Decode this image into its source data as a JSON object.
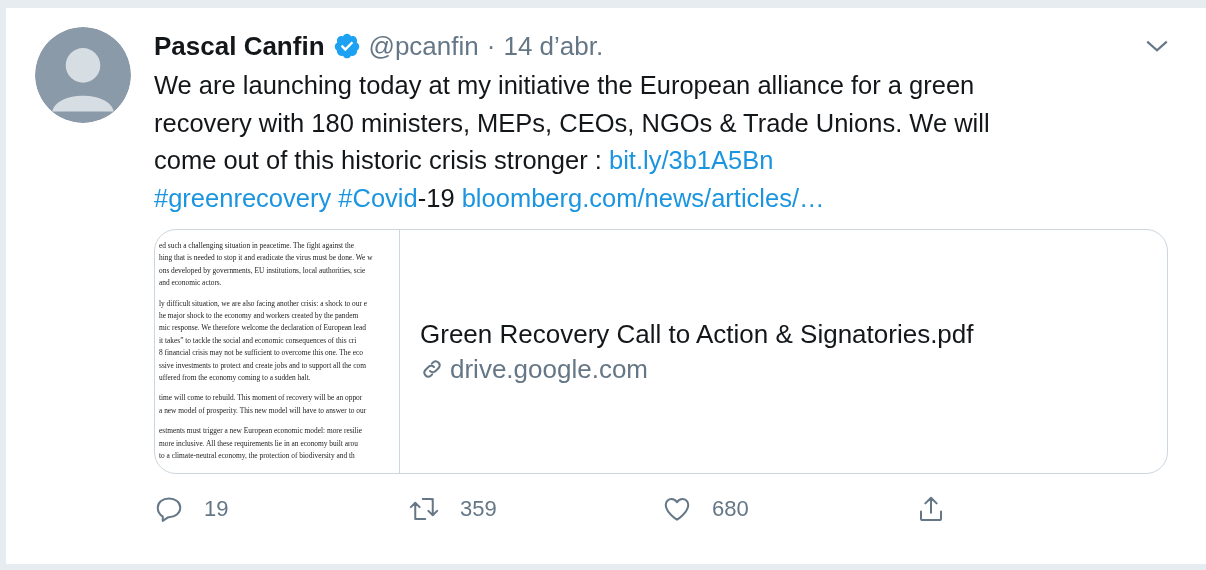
{
  "tweet": {
    "name": "Pascal Canfin",
    "verified": true,
    "handle": "@pcanfin",
    "separator": "·",
    "date": "14 d’abr.",
    "body": [
      [
        {
          "kind": "text",
          "text": "We are launching today at my initiative the European alliance for a green"
        }
      ],
      [
        {
          "kind": "text",
          "text": "recovery with 180 ministers, MEPs, CEOs, NGOs & Trade Unions. We will"
        }
      ],
      [
        {
          "kind": "text",
          "text": "come out of this historic crisis stronger :"
        },
        {
          "kind": "link",
          "text": "bit.ly/3b1A5Bn"
        }
      ],
      [
        {
          "kind": "link",
          "text": "#greenrecovery"
        },
        {
          "kind": "link",
          "text": "#Covid"
        },
        {
          "kind": "text",
          "text": "-19"
        },
        {
          "kind": "link",
          "text": "bloomberg.com/news/articles/…"
        }
      ]
    ],
    "card": {
      "preview": [
        [
          "ed such a challenging situation in peacetime. The fight against the",
          "hing that is needed to stop it and eradicate the virus must be done. We w",
          "ons developed by governments, EU institutions, local authorities, scie",
          "and economic actors."
        ],
        [
          "ly difficult situation, we are also facing another crisis: a shock to our e",
          "he major shock to the economy and workers created by the pandem",
          "mic response. We therefore welcome the declaration of European lead",
          "it takes” to tackle the social and economic consequences of this cri",
          "8 financial crisis may not be sufficient to overcome this one. The eco",
          "ssive investments to protect and create jobs and to support all the com",
          "uffered from the economy coming to a sudden halt."
        ],
        [
          "time will come to rebuild. This moment of recovery will be an oppor",
          "a new model of prosperity. This new model will have to answer to our"
        ],
        [
          "estments must trigger a new European economic model: more resilie",
          "more inclusive. All these requirements lie in an economy built arou",
          "to a climate-neutral economy, the protection of biodiversity and th"
        ]
      ],
      "title": "Green Recovery Call to Action & Signatories.pdf",
      "domain": "drive.google.com"
    },
    "actions": [
      {
        "kind": "reply",
        "count": "19"
      },
      {
        "kind": "retweet",
        "count": "359"
      },
      {
        "kind": "like",
        "count": "680"
      },
      {
        "kind": "share"
      }
    ]
  }
}
